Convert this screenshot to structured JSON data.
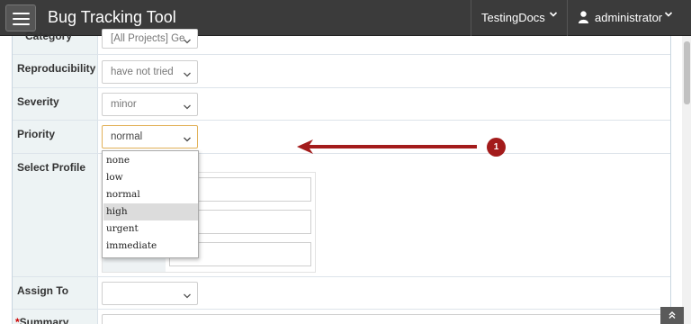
{
  "header": {
    "app_title": "Bug Tracking Tool",
    "project_selector": "TestingDocs",
    "user_menu": "administrator",
    "menu_icon": "hamburger-icon",
    "user_icon": "user-icon",
    "chevron_icon": "chevron-down-icon"
  },
  "form": {
    "category": {
      "label": "Category",
      "value": "[All Projects] General"
    },
    "reproducibility": {
      "label": "Reproducibility",
      "value": "have not tried"
    },
    "severity": {
      "label": "Severity",
      "value": "minor"
    },
    "priority": {
      "label": "Priority",
      "value": "normal"
    },
    "select_profile": {
      "label": "Select Profile"
    },
    "assign_to": {
      "label": "Assign To",
      "value": ""
    },
    "summary": {
      "label": "Summary",
      "required_mark": "*"
    }
  },
  "priority_dropdown": {
    "options": [
      "none",
      "low",
      "normal",
      "high",
      "urgent",
      "immediate"
    ],
    "highlighted": "high"
  },
  "annotation": {
    "number": "1",
    "color": "#a31b1b"
  },
  "colors": {
    "navbar": "#3b3b3b",
    "label_column": "#edf3f4",
    "focus_border": "#e2b25a"
  }
}
